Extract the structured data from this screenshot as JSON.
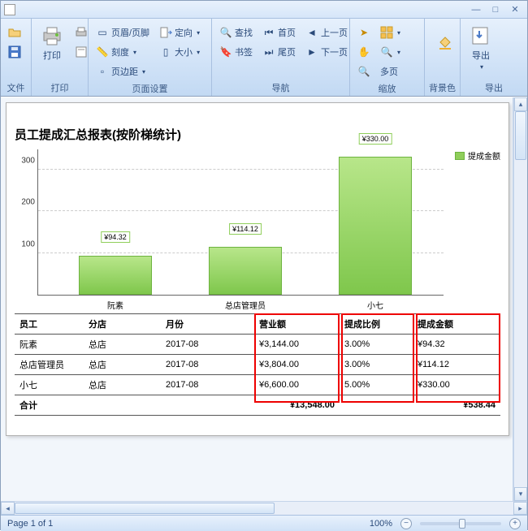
{
  "window": {
    "minimize": "—",
    "maximize": "□",
    "close": "✕"
  },
  "ribbon": {
    "file": {
      "label": "文件",
      "open": "打开",
      "save": "保存"
    },
    "print": {
      "label": "打印",
      "print_btn": "打印",
      "quick_print": "快速打印"
    },
    "page_setup": {
      "label": "页面设置",
      "header_footer": "页眉/页脚",
      "scale": "刻度",
      "margins": "页边距",
      "orientation": "定向",
      "size": "大小"
    },
    "nav": {
      "label": "导航",
      "find": "查找",
      "bookmarks": "书签",
      "first": "首页",
      "prev": "上一页",
      "next": "下一页",
      "last": "尾页"
    },
    "zoom": {
      "label": "缩放",
      "many": "多页"
    },
    "bg": {
      "label": "背景色"
    },
    "export": {
      "label": "导出",
      "btn": "导出"
    }
  },
  "report": {
    "title": "员工提成汇总报表(按阶梯统计)",
    "legend": "提成金额",
    "columns": [
      "员工",
      "分店",
      "月份",
      "营业额",
      "提成比例",
      "提成金额"
    ],
    "rows": [
      {
        "emp": "阮素",
        "branch": "总店",
        "month": "2017-08",
        "sales": "¥3,144.00",
        "rate": "3.00%",
        "comm": "¥94.32"
      },
      {
        "emp": "总店管理员",
        "branch": "总店",
        "month": "2017-08",
        "sales": "¥3,804.00",
        "rate": "3.00%",
        "comm": "¥114.12"
      },
      {
        "emp": "小七",
        "branch": "总店",
        "month": "2017-08",
        "sales": "¥6,600.00",
        "rate": "5.00%",
        "comm": "¥330.00"
      }
    ],
    "total_label": "合计",
    "total_sales": "¥13,548.00",
    "total_comm": "¥538.44"
  },
  "chart_data": {
    "type": "bar",
    "categories": [
      "阮素",
      "总店管理员",
      "小七"
    ],
    "values": [
      94.32,
      114.12,
      330.0
    ],
    "value_labels": [
      "¥94.32",
      "¥114.12",
      "¥330.00"
    ],
    "title": "",
    "ylabel": "",
    "ylim": [
      0,
      350
    ],
    "yticks": [
      100,
      200,
      300
    ],
    "legend": "提成金额"
  },
  "status": {
    "page": "Page 1 of 1",
    "zoom": "100%"
  }
}
